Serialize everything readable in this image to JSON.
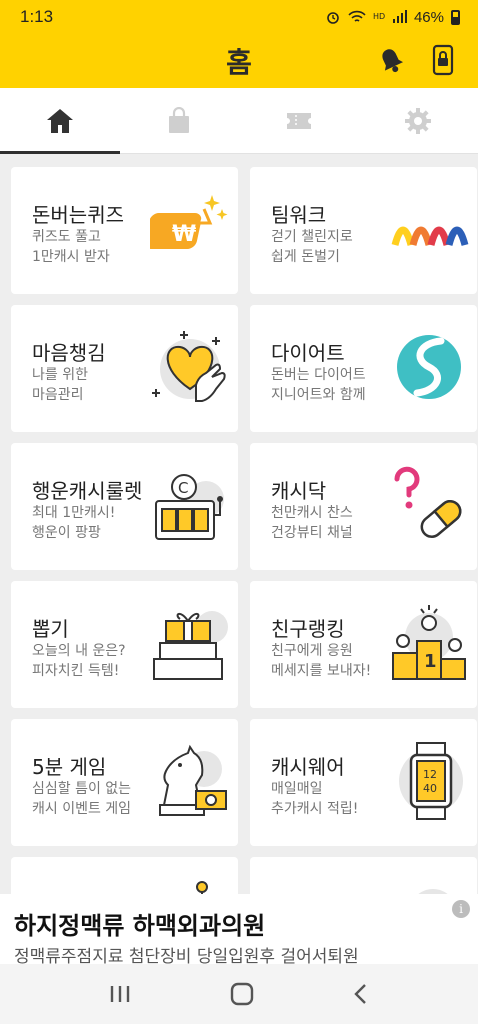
{
  "status": {
    "time": "1:13",
    "battery": "46%"
  },
  "header": {
    "title": "홈"
  },
  "tabs": [
    {
      "name": "home",
      "icon": "home-icon"
    },
    {
      "name": "shop",
      "icon": "shopping-bag-icon"
    },
    {
      "name": "ticket",
      "icon": "ticket-icon"
    },
    {
      "name": "settings",
      "icon": "gear-icon"
    }
  ],
  "cards": [
    {
      "title": "돈버는퀴즈",
      "desc": "퀴즈도 풀고\n1만캐시 받자",
      "icon": "quiz-coin-icon"
    },
    {
      "title": "팀워크",
      "desc": "걷기 챌린지로\n쉽게 돈벌기",
      "icon": "teamwork-icon"
    },
    {
      "title": "마음챙김",
      "desc": "나를 위한\n마음관리",
      "icon": "heart-hand-icon"
    },
    {
      "title": "다이어트",
      "desc": "돈버는 다이어트\n지니어트와 함께",
      "icon": "diet-logo-icon"
    },
    {
      "title": "행운캐시룰렛",
      "desc": "최대 1만캐시!\n행운이 팡팡",
      "icon": "slot-machine-icon"
    },
    {
      "title": "캐시닥",
      "desc": "천만캐시 찬스\n건강뷰티 채널",
      "icon": "pill-icon"
    },
    {
      "title": "뽑기",
      "desc": "오늘의 내 운은?\n피자치킨 득템!",
      "icon": "gift-box-icon"
    },
    {
      "title": "친구랭킹",
      "desc": "친구에게 응원\n메세지를 보내자!",
      "icon": "podium-icon"
    },
    {
      "title": "5분 게임",
      "desc": "심심할 틈이 없는\n캐시 이벤트 게임",
      "icon": "chess-knight-icon"
    },
    {
      "title": "캐시웨어",
      "desc": "매일매일\n추가캐시 적립!",
      "icon": "smartwatch-icon"
    },
    {
      "title": "",
      "desc": "",
      "icon": "partial-icon"
    },
    {
      "title": "",
      "desc": "",
      "icon": "partial-icon"
    }
  ],
  "watch": {
    "line1": "12",
    "line2": "40"
  },
  "ad": {
    "title": "하지정맥류 하맥외과의원",
    "subtitle": "정맥류주점지료 첨단장비 당일입원후 걸어서퇴원",
    "info": "i"
  },
  "colors": {
    "brand_yellow": "#ffd200",
    "card_bg": "#ffffff",
    "page_bg": "#eeeeee"
  }
}
